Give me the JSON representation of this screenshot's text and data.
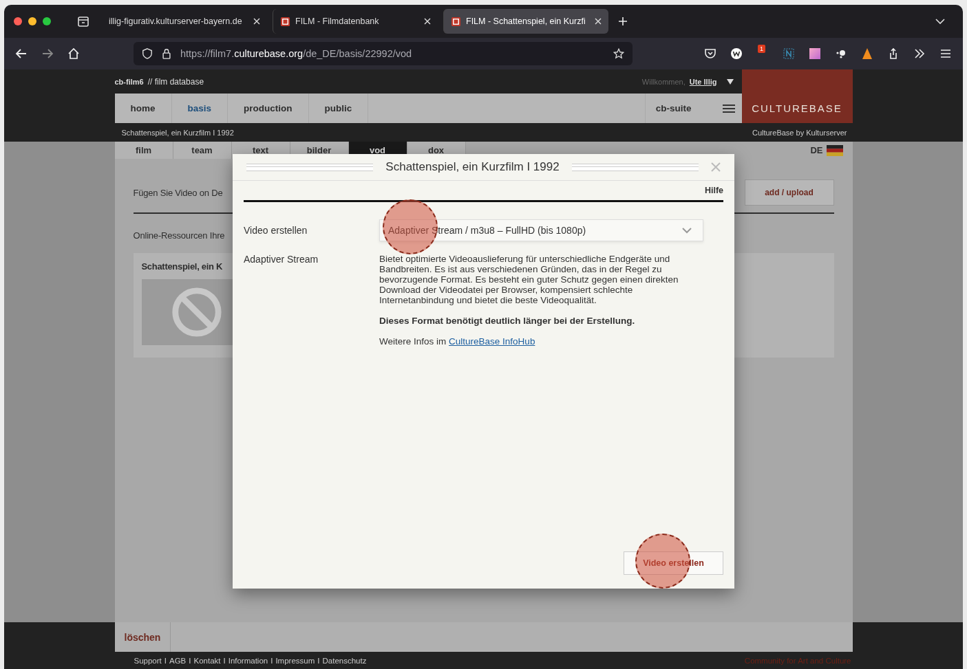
{
  "browser": {
    "tabs": [
      {
        "title": "illig-figurativ.kulturserver-bayern.de",
        "favicon": false,
        "selected": false
      },
      {
        "title": "FILM - Filmdatenbank",
        "favicon": true,
        "selected": false
      },
      {
        "title": "FILM - Schattenspiel, ein Kurzfi",
        "favicon": true,
        "selected": true
      }
    ],
    "url": {
      "scheme": "https://film7.",
      "domain": "culturebase.org",
      "path": "/de_DE/basis/22992/vod"
    },
    "notification_badge": "1"
  },
  "header": {
    "brand": "cb-film6",
    "subtitle": "// film database",
    "welcome": "Willkommen,",
    "user": "Ute Illig",
    "logo": "CULTUREBASE",
    "breadcrumb": "Schattenspiel, ein Kurzfilm I 1992",
    "byline": "CultureBase by Kulturserver",
    "suite": "cb-suite",
    "nav": [
      {
        "label": "home",
        "selected": false
      },
      {
        "label": "basis",
        "selected": true
      },
      {
        "label": "production",
        "selected": false
      },
      {
        "label": "public",
        "selected": false
      }
    ]
  },
  "subtabs": [
    {
      "label": "film",
      "selected": false
    },
    {
      "label": "team",
      "selected": false
    },
    {
      "label": "text",
      "selected": false
    },
    {
      "label": "bilder",
      "selected": false
    },
    {
      "label": "vod",
      "selected": true
    },
    {
      "label": "dox",
      "selected": false
    }
  ],
  "language": "DE",
  "content": {
    "intro": "Fügen Sie Video on De",
    "add_button": "add / upload",
    "resources": "Online-Ressourcen Ihre",
    "card_title": "Schattenspiel, ein K"
  },
  "modal": {
    "title": "Schattenspiel, ein Kurzfilm I 1992",
    "help": "Hilfe",
    "select_label": "Video erstellen",
    "select_value": "Adaptiver Stream / m3u8 – FullHD (bis 1080p)",
    "info_label": "Adaptiver Stream",
    "description": "Bietet optimierte Videoauslieferung für unterschiedliche Endgeräte und Bandbreiten. Es ist aus verschiedenen Gründen, das in der Regel zu bevorzugende Format. Es besteht ein guter Schutz gegen einen direkten Download der Videodatei per Browser, kompensiert schlechte Internetanbindung und bietet die beste Videoqualität.",
    "warning": "Dieses Format benötigt deutlich länger bei der Erstellung.",
    "more_prefix": "Weitere Infos im",
    "more_link": "CultureBase InfoHub",
    "submit": "Video erstellen"
  },
  "footer": {
    "delete": "löschen",
    "links": [
      {
        "label": "Support",
        "separator": "I"
      },
      {
        "label": "AGB",
        "separator": "I"
      },
      {
        "label": "Kontakt",
        "separator": "I"
      },
      {
        "label": "Information",
        "separator": "I"
      },
      {
        "label": "Impressum",
        "separator": "I"
      },
      {
        "label": "Datenschutz"
      }
    ],
    "tagline": "Community for Art and Culture"
  }
}
